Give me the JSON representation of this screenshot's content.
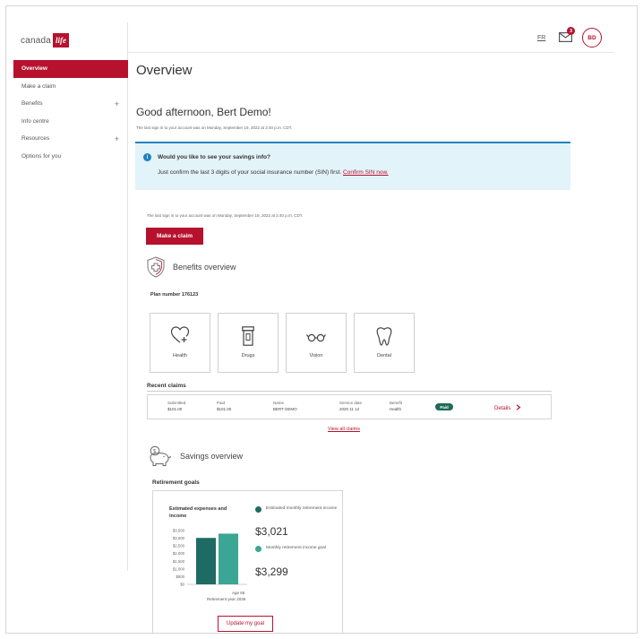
{
  "logo": {
    "word": "canada",
    "mark": "life"
  },
  "nav": {
    "items": [
      {
        "label": "Overview",
        "active": true,
        "expandable": false
      },
      {
        "label": "Make a claim",
        "active": false,
        "expandable": false
      },
      {
        "label": "Benefits",
        "active": false,
        "expandable": true
      },
      {
        "label": "Info centre",
        "active": false,
        "expandable": false
      },
      {
        "label": "Resources",
        "active": false,
        "expandable": true
      },
      {
        "label": "Options for you",
        "active": false,
        "expandable": false
      }
    ],
    "plus": "+"
  },
  "topbar": {
    "lang": "FR",
    "message_count": "3",
    "avatar_initials": "BD"
  },
  "main": {
    "title": "Overview",
    "greeting": "Good afternoon, Bert Demo!",
    "last_signin": "The last sign in to your account was on Monday, September 19, 2022 at 2:40 p.m. CDT.",
    "banner": {
      "icon": "i",
      "title": "Would you like to see your savings info?",
      "text": "Just confirm the last 3 digits of your social insurance number (SIN) first.",
      "link": "Confirm SIN now."
    },
    "last_signin_2": "The last sign in to your account was on Monday, September 19, 2022 at 2:40 p.m. CDT.",
    "make_claim": "Make a claim"
  },
  "benefits": {
    "heading": "Benefits overview",
    "plan_number": "Plan number 176123",
    "tiles": [
      {
        "label": "Health",
        "icon": "health-icon"
      },
      {
        "label": "Drugs",
        "icon": "drugs-icon"
      },
      {
        "label": "Vision",
        "icon": "vision-icon"
      },
      {
        "label": "Dental",
        "icon": "dental-icon"
      }
    ]
  },
  "recent_claims": {
    "title": "Recent claims",
    "columns": [
      {
        "header": "Submitted",
        "value": "$101.00"
      },
      {
        "header": "Paid",
        "value": "$101.00"
      },
      {
        "header": "Name",
        "value": "BERT DEMO"
      },
      {
        "header": "Service date",
        "value": "2020 11 12"
      },
      {
        "header": "Benefit",
        "value": "Health"
      }
    ],
    "status": "Paid",
    "details": "Details",
    "view_all": "View all claims"
  },
  "savings": {
    "heading": "Savings overview",
    "retirement_title": "Retirement goals",
    "card": {
      "chart_title": "Estimated expenses and income",
      "x_label_1": "Age 65",
      "x_label_2": "Retirement year 2036",
      "legend": [
        {
          "label": "Estimated monthly retirement income",
          "value": "$3,021",
          "color": "#1e6b63"
        },
        {
          "label": "Monthly retirement income goal",
          "value": "$3,299",
          "color": "#3aa693"
        }
      ],
      "update_button": "Update my goal"
    }
  },
  "chart_data": {
    "type": "bar",
    "title": "Estimated expenses and income",
    "categories": [
      "Age 65"
    ],
    "series": [
      {
        "name": "Estimated monthly retirement income",
        "values": [
          3021
        ]
      },
      {
        "name": "Monthly retirement income goal",
        "values": [
          3299
        ]
      }
    ],
    "y_ticks": [
      "$3,500",
      "$3,000",
      "$2,500",
      "$2,000",
      "$1,500",
      "$1,000",
      "$500",
      "$0"
    ],
    "ylim": [
      0,
      3500
    ],
    "colors": [
      "#1e6b63",
      "#3aa693"
    ]
  }
}
